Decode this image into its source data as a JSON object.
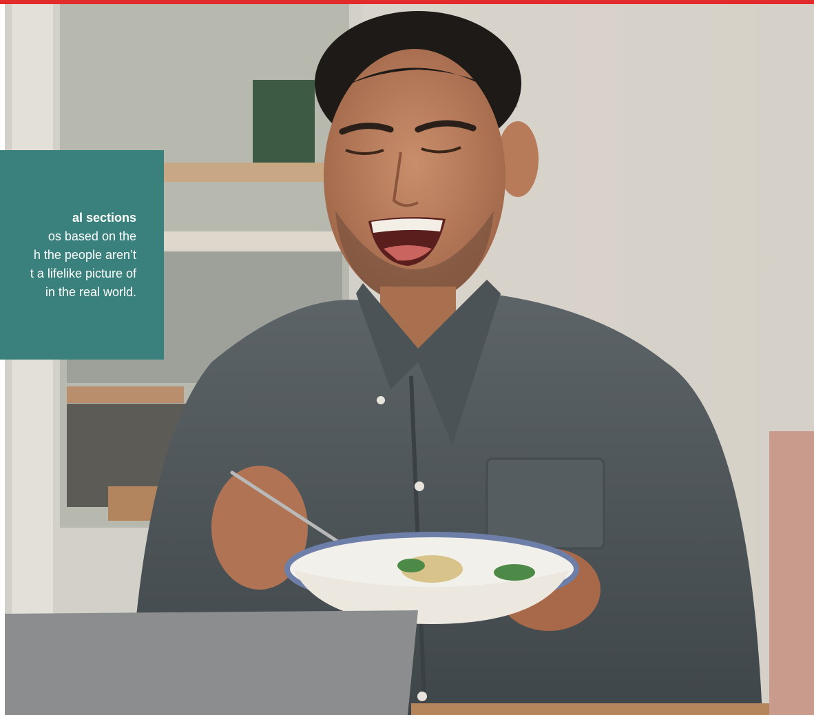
{
  "colors": {
    "top_bar": "#e42b2b",
    "panel_background": "#3a807c",
    "panel_text": "#ffffff"
  },
  "photo": {
    "icon": "photo-scene"
  },
  "info_panel": {
    "title": "al sections",
    "lines": [
      "os based on the",
      "h the people aren’t",
      "t a lifelike picture of",
      "in the real world."
    ]
  }
}
